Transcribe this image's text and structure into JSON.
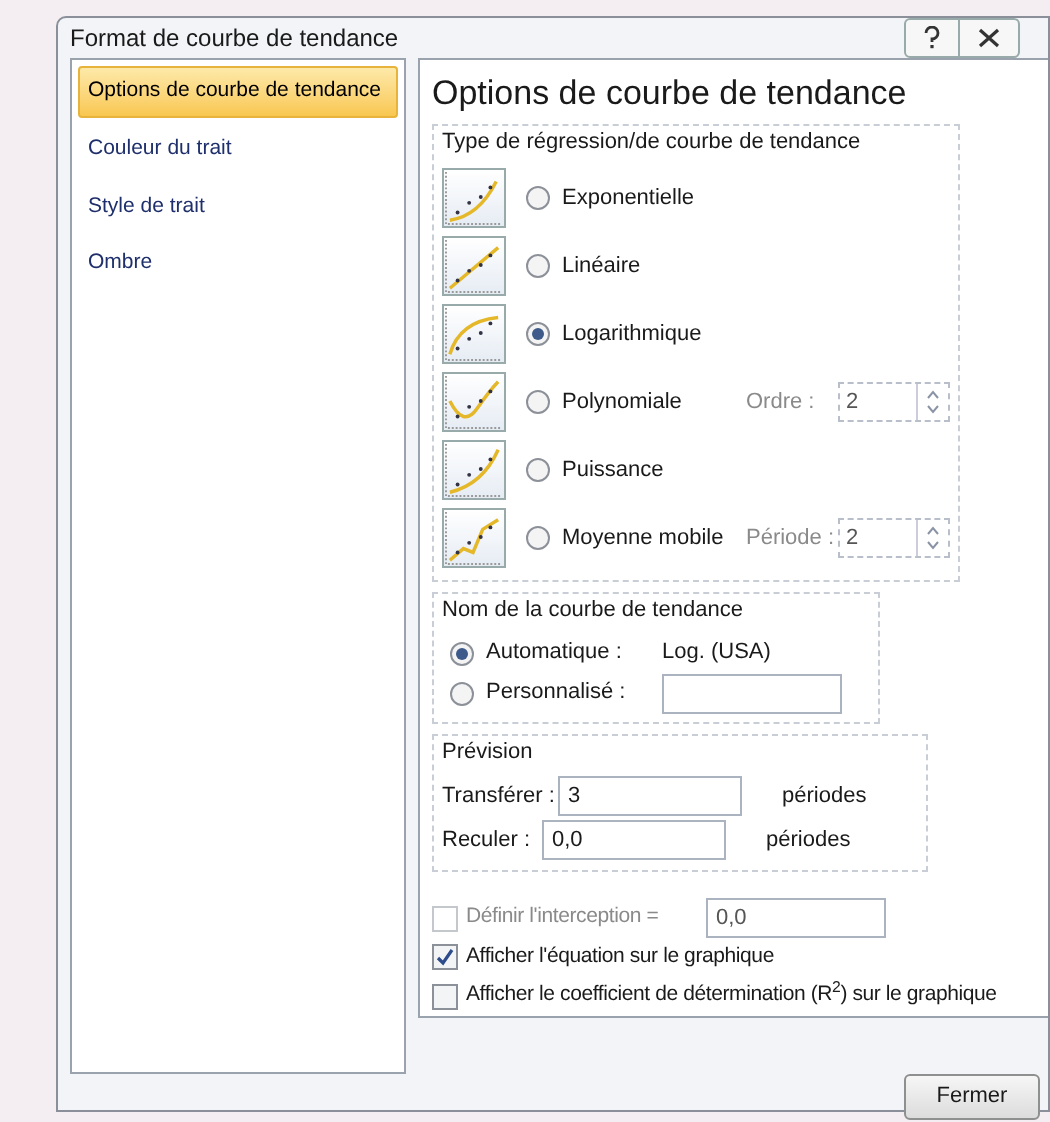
{
  "window": {
    "title": "Format de courbe de tendance"
  },
  "sidebar": {
    "items": [
      {
        "label": "Options de courbe de tendance",
        "selected": true
      },
      {
        "label": "Couleur du trait",
        "selected": false
      },
      {
        "label": "Style de trait",
        "selected": false
      },
      {
        "label": "Ombre",
        "selected": false
      }
    ]
  },
  "panel": {
    "heading": "Options de courbe de tendance",
    "regression": {
      "title": "Type de régression/de courbe de tendance",
      "options": [
        {
          "kind": "exponential",
          "label": "Exponentielle",
          "selected": false
        },
        {
          "kind": "linear",
          "label": "Linéaire",
          "selected": false
        },
        {
          "kind": "logarithmic",
          "label": "Logarithmique",
          "selected": true
        },
        {
          "kind": "polynomial",
          "label": "Polynomiale",
          "selected": false,
          "param": {
            "label": "Ordre :",
            "value": "2",
            "disabled": true
          }
        },
        {
          "kind": "power",
          "label": "Puissance",
          "selected": false
        },
        {
          "kind": "moving",
          "label": "Moyenne mobile",
          "selected": false,
          "param": {
            "label": "Période :",
            "value": "2",
            "disabled": true
          }
        }
      ]
    },
    "name_group": {
      "title": "Nom de la courbe de tendance",
      "options": [
        {
          "kind": "text",
          "label": "Automatique :",
          "selected": true,
          "value": "Log. (USA)"
        },
        {
          "kind": "field",
          "label": "Personnalisé :",
          "selected": false
        }
      ]
    },
    "forecast": {
      "title": "Prévision",
      "rows": [
        {
          "label": "Transférer :",
          "value": "3",
          "unit": "périodes"
        },
        {
          "label": "Reculer :",
          "value": "0,0",
          "unit": "périodes"
        }
      ]
    },
    "checks": [
      {
        "label": "Définir l'interception =",
        "checked": false,
        "disabled": true,
        "value": "0,0"
      },
      {
        "label": "Afficher l'équation sur le graphique",
        "checked": true,
        "disabled": false
      },
      {
        "label": "Afficher le coefficient de détermination (R$^{2}$) sur le graphique",
        "checked": false,
        "disabled": false
      }
    ]
  },
  "buttons": [
    "Fermer"
  ]
}
